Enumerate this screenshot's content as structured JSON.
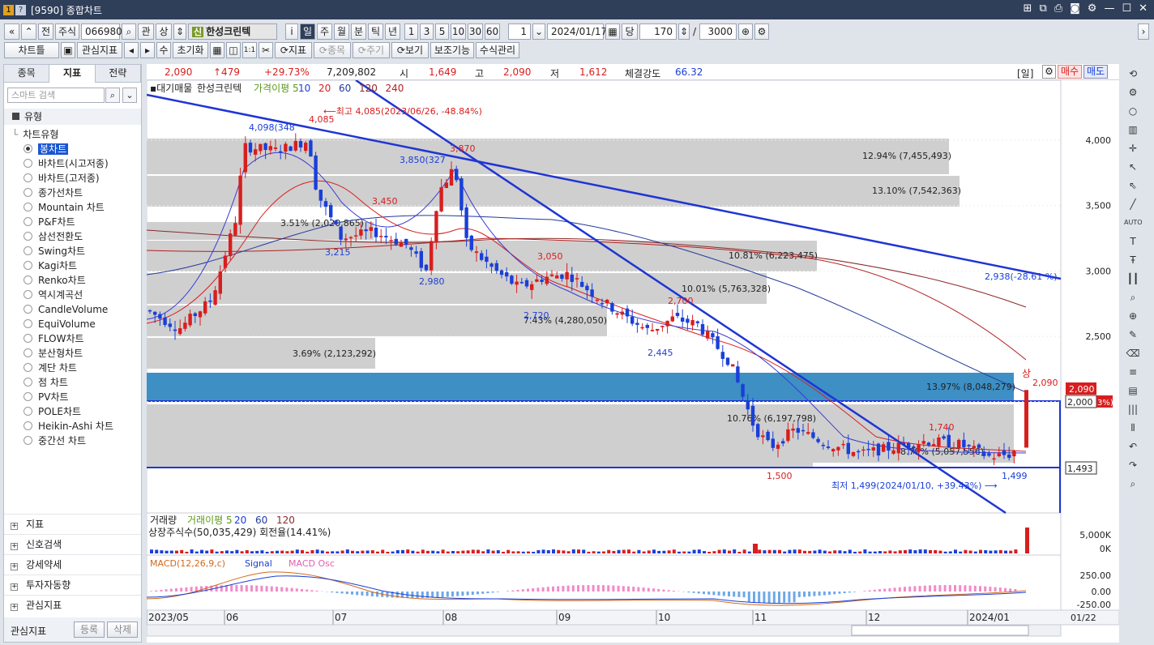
{
  "window": {
    "title": "[9590] 종합차트",
    "number": "1",
    "help": "?"
  },
  "toolbar1": {
    "type_label": "주식",
    "code": "066980",
    "gwan": "관",
    "sang": "상",
    "shin": "신",
    "stock_name": "한성크린텍",
    "info": "i",
    "periods": [
      "일",
      "주",
      "월",
      "분",
      "틱",
      "년"
    ],
    "intervals": [
      "1",
      "3",
      "5",
      "10",
      "30",
      "60"
    ],
    "count_value": "1",
    "date": "2024/01/17",
    "dang": "당",
    "bars": "170",
    "slash": "/",
    "total": "3000",
    "prev": "전"
  },
  "toolbar2": {
    "buttons": [
      "차트틀",
      "관심지표",
      "수",
      "초기화",
      "1:1",
      "지표",
      "종목",
      "주기",
      "보기",
      "보조기능",
      "수식관리"
    ]
  },
  "quote": {
    "price": "2,090",
    "change": "↑479",
    "rate": "+29.73%",
    "volume": "7,209,802",
    "open_label": "시",
    "open": "1,649",
    "high_label": "고",
    "high": "2,090",
    "low_label": "저",
    "low": "1,612",
    "strength_label": "체결강도",
    "strength": "66.32",
    "period": "[일]",
    "buy": "매수",
    "sell": "매도"
  },
  "left_panel": {
    "tabs": [
      "종목",
      "지표",
      "전략"
    ],
    "search_placeholder": "스마트 검색",
    "section": "유형",
    "tree_label": "차트유형",
    "chart_types": [
      "봉차트",
      "바차트(시고저종)",
      "바차트(고저종)",
      "종가선차트",
      "Mountain 차트",
      "P&F차트",
      "삼선전환도",
      "Swing차트",
      "Kagi차트",
      "Renko차트",
      "역시계곡선",
      "CandleVolume",
      "EquiVolume",
      "FLOW차트",
      "분산형차트",
      "계단 차트",
      "점 차트",
      "PV차트",
      "POLE차트",
      "Heikin-Ashi 차트",
      "중간선 차트"
    ],
    "selected": "봉차트",
    "bottom_items": [
      "지표",
      "신호검색",
      "강세약세",
      "투자자동향",
      "관심지표"
    ],
    "footer_label": "관심지표",
    "register": "등록",
    "delete": "삭제"
  },
  "chart": {
    "legend_price": [
      "대기매물",
      "한성크린텍",
      "가격이평 5",
      "10",
      "20",
      "60",
      "120",
      "240"
    ],
    "legend_volume": [
      "거래량",
      "거래이평 5",
      "20",
      "60",
      "120"
    ],
    "listed_shares": "상장주식수(50,035,429) 회전율(14.41%)",
    "legend_macd": [
      "MACD(12,26,9,c)",
      "Signal",
      "MACD Osc"
    ],
    "price_ticks": [
      "4,000",
      "3,500",
      "3,000",
      "2,500",
      "2,000"
    ],
    "volume_ticks": [
      "5,000K",
      "0K"
    ],
    "macd_ticks": [
      "250.00",
      "0.00",
      "-250.00"
    ],
    "x_labels": [
      "2023/05",
      "06",
      "07",
      "08",
      "09",
      "10",
      "11",
      "12",
      "2024/01"
    ],
    "x_right": "01/22",
    "current_price_tag": "2,090",
    "level_tag_2000": "2,000",
    "level_tag_2000_suffix": "3%)",
    "level_tag_1493": "1,493",
    "annotations": {
      "high_note": "최고 4,085(2023/06/26, -48.84%)",
      "low_note": "최저 1,499(2024/01/10, +39.43%)",
      "trend_value": "2,938(-28.61 %)",
      "up_label": "상"
    },
    "supply_bands": [
      {
        "pct": "12.94% (7,455,493)"
      },
      {
        "pct": "13.10% (7,542,363)"
      },
      {
        "pct": "3.51% (2,020,865)"
      },
      {
        "pct": "10.81% (6,223,475)"
      },
      {
        "pct": "10.01% (5,763,328)"
      },
      {
        "pct": "7.43% (4,280,050)"
      },
      {
        "pct": "3.69% (2,123,292)"
      },
      {
        "pct": "13.97% (8,048,279)"
      },
      {
        "pct": "10.76% (6,197,798)"
      },
      {
        "pct": "8.79% (5,057,556)"
      }
    ],
    "price_labels": [
      "4,098(348",
      "4,085",
      "3,850(327",
      "3,870",
      "3,450",
      "3,215",
      "2,980",
      "3,050",
      "2,720",
      "2,700",
      "2,445",
      "1,500",
      "1,740",
      "1,499",
      "2,090"
    ],
    "colors": {
      "up": "#d81e1e",
      "down": "#1a3fd8",
      "band": "#cfcfcf",
      "band_hl": "#3d8fc4",
      "trend": "#1f35d4"
    }
  }
}
